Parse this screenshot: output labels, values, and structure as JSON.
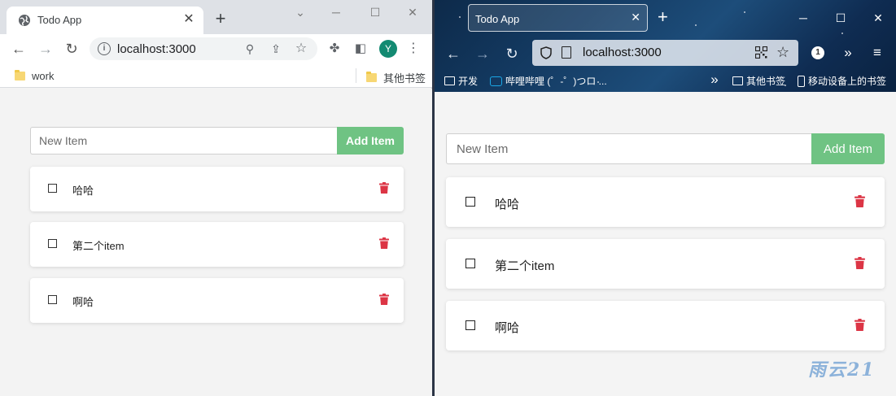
{
  "left_window": {
    "tab_title": "Todo App",
    "tab_close": "✕",
    "new_tab": "+",
    "window_controls": {
      "minimize": "─",
      "restore": "☐",
      "close": "✕",
      "dropdown": "⌄"
    },
    "url": "localhost:3000",
    "avatar_letter": "Y",
    "bookmarks": {
      "left": "work",
      "right": "其他书签"
    },
    "todo": {
      "placeholder": "New Item",
      "add_label": "Add Item",
      "items": [
        {
          "label": "哈哈"
        },
        {
          "label": "第二个item"
        },
        {
          "label": "啊哈"
        }
      ]
    }
  },
  "right_window": {
    "tab_title": "Todo App",
    "tab_close": "✕",
    "new_tab": "+",
    "window_controls": {
      "minimize": "─",
      "restore": "☐",
      "close": "✕"
    },
    "url": "localhost:3000",
    "extension_badge": "1",
    "bookmarks": {
      "item1": "开发",
      "item2": "哔哩哔哩 (゜-゜)つロ ...",
      "item3": "其他书签",
      "item4": "移动设备上的书签"
    },
    "todo": {
      "placeholder": "New Item",
      "add_label": "Add Item",
      "items": [
        {
          "label": "哈哈"
        },
        {
          "label": "第二个item"
        },
        {
          "label": "啊哈"
        }
      ]
    }
  },
  "watermark": "雨云21",
  "colors": {
    "add_button": "#6fc383",
    "trash": "#dc3545",
    "avatar": "#138a72"
  }
}
